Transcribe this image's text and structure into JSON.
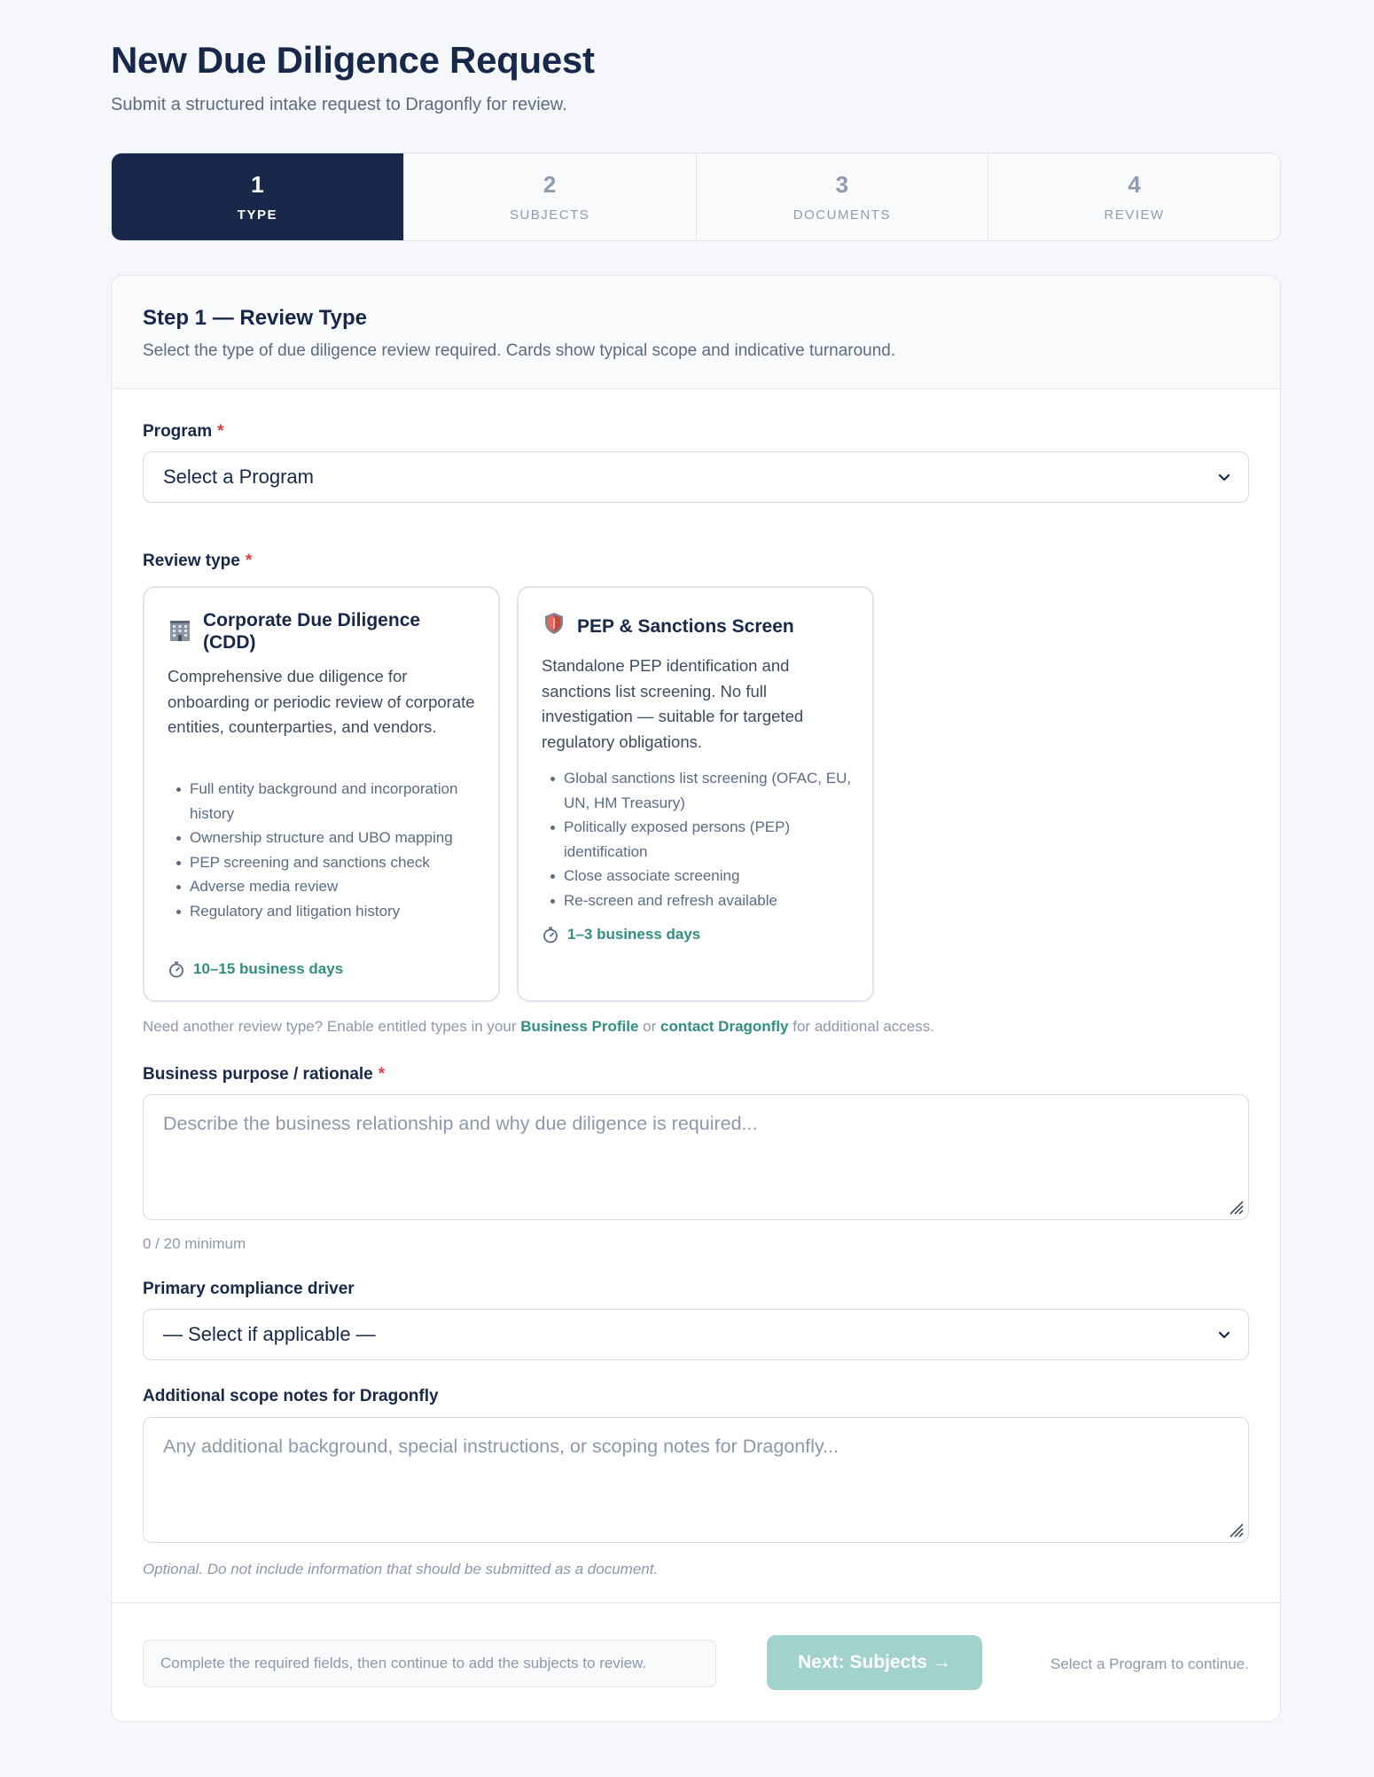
{
  "header": {
    "title": "New Due Diligence Request",
    "subtitle": "Submit a structured intake request to Dragonfly for review."
  },
  "stepper": {
    "steps": [
      {
        "number": "1",
        "label": "TYPE",
        "active": true
      },
      {
        "number": "2",
        "label": "SUBJECTS",
        "active": false
      },
      {
        "number": "3",
        "label": "DOCUMENTS",
        "active": false
      },
      {
        "number": "4",
        "label": "REVIEW",
        "active": false
      }
    ]
  },
  "panel": {
    "title": "Step 1 — Review Type",
    "description": "Select the type of due diligence review required. Cards show typical scope and indicative turnaround."
  },
  "program": {
    "label": "Program",
    "required_mark": "*",
    "selected": "Select a Program"
  },
  "review_type": {
    "label": "Review type",
    "required_mark": "*",
    "cards": [
      {
        "icon": "office-building-icon",
        "title_line1": "Corporate Due Diligence",
        "title_line2": "(CDD)",
        "description": "Comprehensive due diligence for onboarding or periodic review of corporate entities, counterparties, and vendors.",
        "features": [
          "Full entity background and incorporation history",
          "Ownership structure and UBO mapping",
          "PEP screening and sanctions check",
          "Adverse media review",
          "Regulatory and litigation history"
        ],
        "turnaround": "10–15 business days"
      },
      {
        "icon": "shield-icon",
        "title_line1": "PEP & Sanctions Screen",
        "description": "Standalone PEP identification and sanctions list screening. No full investigation — suitable for targeted regulatory obligations.",
        "features": [
          "Global sanctions list screening (OFAC, EU, UN, HM Treasury)",
          "Politically exposed persons (PEP) identification",
          "Close associate screening",
          "Re-screen and refresh available"
        ],
        "turnaround": "1–3 business days"
      }
    ],
    "help_prefix": "Need another review type? Enable entitled types in your ",
    "help_link1": "Business Profile",
    "help_mid": " or ",
    "help_link2": "contact Dragonfly",
    "help_suffix": " for additional access."
  },
  "business_purpose": {
    "label": "Business purpose / rationale",
    "required_mark": "*",
    "placeholder": "Describe the business relationship and why due diligence is required...",
    "counter": "0 / 20 minimum"
  },
  "compliance_driver": {
    "label": "Primary compliance driver",
    "selected": "— Select if applicable —"
  },
  "scope_notes": {
    "label": "Additional scope notes for Dragonfly",
    "placeholder": "Any additional background, special instructions, or scoping notes for Dragonfly...",
    "hint": "Optional. Do not include information that should be submitted as a document."
  },
  "footer": {
    "note": "Complete the required fields, then continue to add the subjects to review.",
    "next_label": "Next: Subjects →",
    "hint": "Select a Program to continue."
  },
  "colors": {
    "navy": "#17284a",
    "teal": "#2f8f80",
    "teal_disabled": "#a2d2cc",
    "required": "#e0393e"
  }
}
